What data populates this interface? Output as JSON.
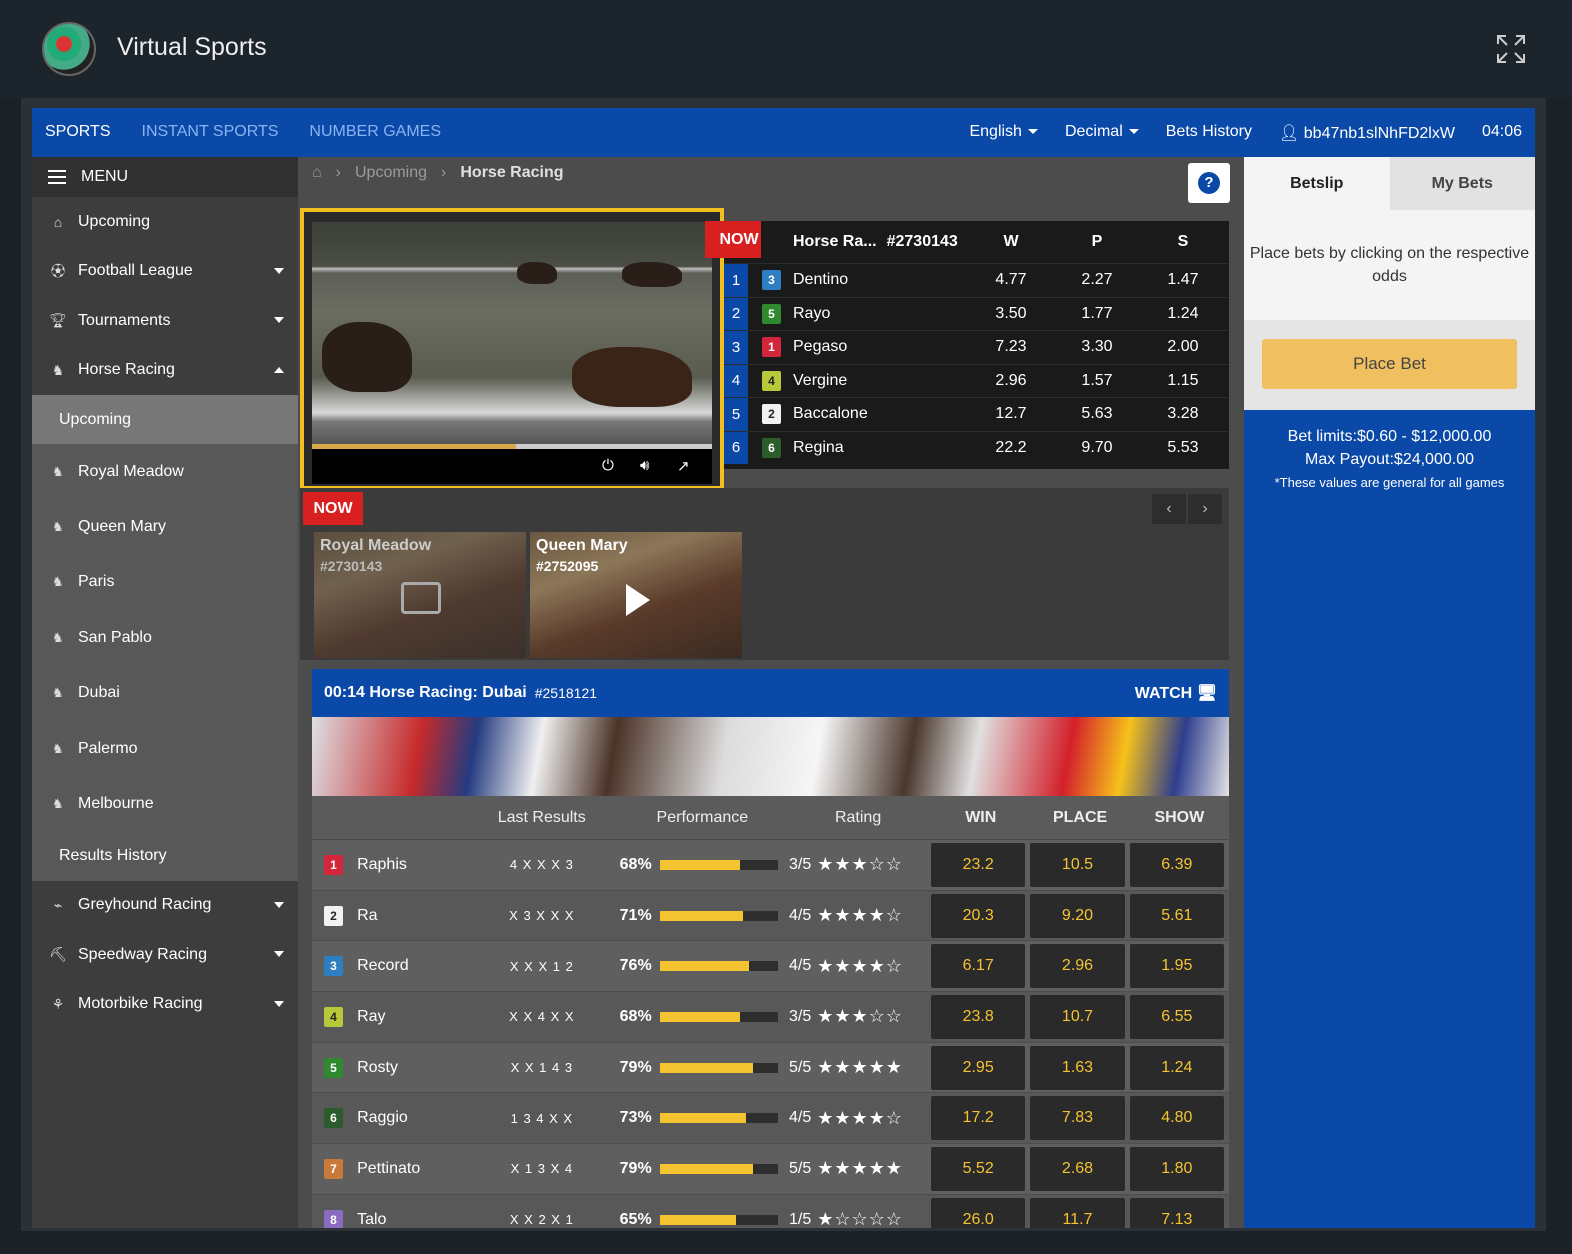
{
  "app": {
    "title": "Virtual Sports"
  },
  "topnav": {
    "left": [
      "SPORTS",
      "INSTANT SPORTS",
      "NUMBER GAMES"
    ],
    "language": "English",
    "odds_format": "Decimal",
    "bets_history": "Bets History",
    "user": "bb47nb1slNhFD2lxW",
    "clock": "04:06"
  },
  "sidebar": {
    "menu_label": "MENU",
    "upcoming": "Upcoming",
    "football": "Football League",
    "tournaments": "Tournaments",
    "horse_racing": "Horse Racing",
    "sub_upcoming": "Upcoming",
    "tracks": [
      {
        "name": "Royal Meadow",
        "icon": "8"
      },
      {
        "name": "Queen Mary",
        "icon": "8"
      },
      {
        "name": "Paris",
        "icon": "8"
      },
      {
        "name": "San Pablo",
        "icon": "10"
      },
      {
        "name": "Dubai",
        "icon": "10"
      },
      {
        "name": "Palermo",
        "icon": "12"
      },
      {
        "name": "Melbourne",
        "icon": "12"
      }
    ],
    "results_history": "Results History",
    "greyhound": "Greyhound Racing",
    "speedway": "Speedway Racing",
    "motorbike": "Motorbike Racing"
  },
  "breadcrumb": {
    "level1": "Upcoming",
    "level2": "Horse Racing"
  },
  "video": {
    "progress": 0.51
  },
  "now_label": "NOW",
  "now_label_clipped": "NOW",
  "odds": {
    "race": "Horse Ra...",
    "race_id": "#2730143",
    "cols": [
      "W",
      "P",
      "S"
    ],
    "rows": [
      {
        "pos": "1",
        "num": "3",
        "color": "#2e7fc1",
        "name": "Dentino",
        "w": "4.77",
        "p": "2.27",
        "s": "1.47"
      },
      {
        "pos": "2",
        "num": "5",
        "color": "#2f8a2f",
        "name": "Rayo",
        "w": "3.50",
        "p": "1.77",
        "s": "1.24"
      },
      {
        "pos": "3",
        "num": "1",
        "color": "#d3263a",
        "name": "Pegaso",
        "w": "7.23",
        "p": "3.30",
        "s": "2.00"
      },
      {
        "pos": "4",
        "num": "4",
        "color": "#b7c83a",
        "name": "Vergine",
        "w": "2.96",
        "p": "1.57",
        "s": "1.15"
      },
      {
        "pos": "5",
        "num": "2",
        "color": "#f2f2f2",
        "name": "Baccalone",
        "w": "12.7",
        "p": "5.63",
        "s": "3.28"
      },
      {
        "pos": "6",
        "num": "6",
        "color": "#2c5b2c",
        "name": "Regina",
        "w": "22.2",
        "p": "9.70",
        "s": "5.53"
      }
    ]
  },
  "streams": [
    {
      "name": "Royal Meadow",
      "id": "#2730143"
    },
    {
      "name": "Queen Mary",
      "id": "#2752095"
    }
  ],
  "race_panel": {
    "title": "00:14 Horse Racing: Dubai",
    "race_id": "#2518121",
    "watch": "WATCH",
    "headers": {
      "last": "Last Results",
      "perf": "Performance",
      "rating": "Rating",
      "win": "WIN",
      "place": "PLACE",
      "show": "SHOW"
    },
    "runners": [
      {
        "num": "1",
        "color": "#d3263a",
        "name": "Raphis",
        "last": "4 X X X 3",
        "perf": "68%",
        "perf_value": 0.68,
        "rating": "3/5",
        "stars": 3,
        "win": "23.2",
        "place": "10.5",
        "show": "6.39"
      },
      {
        "num": "2",
        "color": "#f2f2f2",
        "name": "Ra",
        "last": "X 3 X X X",
        "perf": "71%",
        "perf_value": 0.71,
        "rating": "4/5",
        "stars": 4,
        "win": "20.3",
        "place": "9.20",
        "show": "5.61"
      },
      {
        "num": "3",
        "color": "#2e7fc1",
        "name": "Record",
        "last": "X X X 1 2",
        "perf": "76%",
        "perf_value": 0.76,
        "rating": "4/5",
        "stars": 4,
        "win": "6.17",
        "place": "2.96",
        "show": "1.95"
      },
      {
        "num": "4",
        "color": "#b7c83a",
        "name": "Ray",
        "last": "X X 4 X X",
        "perf": "68%",
        "perf_value": 0.68,
        "rating": "3/5",
        "stars": 3,
        "win": "23.8",
        "place": "10.7",
        "show": "6.55"
      },
      {
        "num": "5",
        "color": "#2f8a2f",
        "name": "Rosty",
        "last": "X X 1 4 3",
        "perf": "79%",
        "perf_value": 0.79,
        "rating": "5/5",
        "stars": 5,
        "win": "2.95",
        "place": "1.63",
        "show": "1.24"
      },
      {
        "num": "6",
        "color": "#2c5b2c",
        "name": "Raggio",
        "last": "1 3 4 X X",
        "perf": "73%",
        "perf_value": 0.73,
        "rating": "4/5",
        "stars": 4,
        "win": "17.2",
        "place": "7.83",
        "show": "4.80"
      },
      {
        "num": "7",
        "color": "#c77a3a",
        "name": "Pettinato",
        "last": "X 1 3 X 4",
        "perf": "79%",
        "perf_value": 0.79,
        "rating": "5/5",
        "stars": 5,
        "win": "5.52",
        "place": "2.68",
        "show": "1.80"
      },
      {
        "num": "8",
        "color": "#8a6bbf",
        "name": "Talo",
        "last": "X X 2 X 1",
        "perf": "65%",
        "perf_value": 0.65,
        "rating": "1/5",
        "stars": 1,
        "win": "26.0",
        "place": "11.7",
        "show": "7.13"
      }
    ]
  },
  "betslip": {
    "tab_betslip": "Betslip",
    "tab_mybets": "My Bets",
    "message": "Place bets by clicking on the respective odds",
    "place_bet": "Place Bet",
    "limits": "Bet limits:$0.60 - $12,000.00",
    "max_payout": "Max Payout:$24,000.00",
    "note": "*These values are general for all games"
  }
}
